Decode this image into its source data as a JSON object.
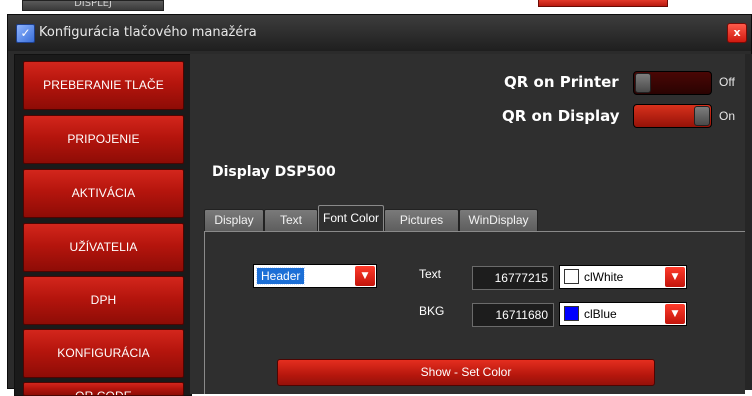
{
  "background_app": {
    "tab_label": "DISPLEJ"
  },
  "window": {
    "title": "Konfigurácia tlačového manažéra",
    "icon": "app-check-icon",
    "close_glyph": "x"
  },
  "sidebar": {
    "items": [
      {
        "label": "PREBERANIE TLAČE"
      },
      {
        "label": "PRIPOJENIE"
      },
      {
        "label": "AKTIVÁCIA"
      },
      {
        "label": "UŽÍVATELIA"
      },
      {
        "label": "DPH"
      },
      {
        "label": "KONFIGURÁCIA"
      },
      {
        "label": "QR CODE"
      }
    ]
  },
  "toggles": {
    "qr_printer": {
      "label": "QR on Printer",
      "state": "Off",
      "on": false
    },
    "qr_display": {
      "label": "QR on Display",
      "state": "On",
      "on": true
    }
  },
  "device": {
    "title": "Display DSP500"
  },
  "tabs": [
    {
      "label": "Display",
      "active": false
    },
    {
      "label": "Text",
      "active": false
    },
    {
      "label": "Font Color",
      "active": true
    },
    {
      "label": "Pictures",
      "active": false
    },
    {
      "label": "WinDisplay",
      "active": false
    }
  ],
  "font_color": {
    "element_select": {
      "value": "Header"
    },
    "text": {
      "label": "Text",
      "value": "16777215",
      "color_name": "clWhite",
      "color": "#ffffff"
    },
    "bkg": {
      "label": "BKG",
      "value": "16711680",
      "color_name": "clBlue",
      "color": "#0000ff"
    },
    "apply_button": "Show - Set Color"
  },
  "colors": {
    "accent_red": "#c2140b",
    "window_bg": "#2f2f2f",
    "selection_blue": "#1c6fd6"
  }
}
